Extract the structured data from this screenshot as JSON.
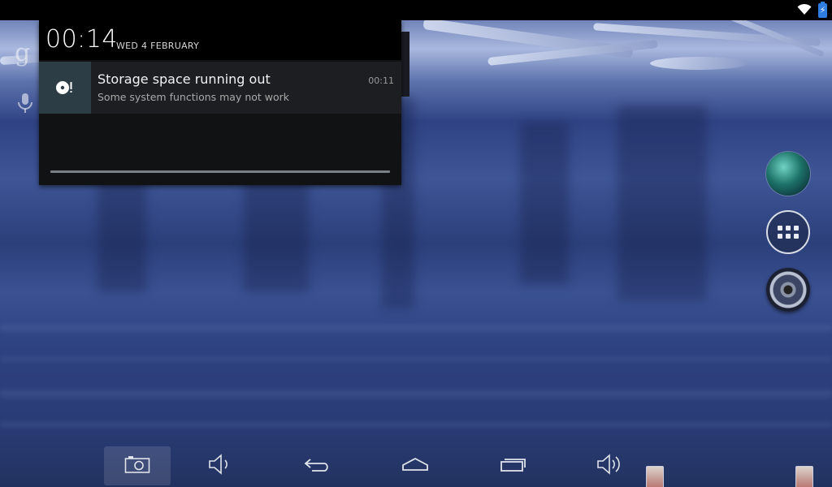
{
  "status_bar": {
    "icons": [
      "wifi-icon",
      "battery-charging-icon"
    ]
  },
  "search_bar": {
    "logo_letter": "g",
    "icons": [
      "mic-icon"
    ]
  },
  "notification_shade": {
    "clock": "00:14",
    "date": "WED 4 FEBRUARY",
    "notifications": [
      {
        "icon": "storage-warning-icon",
        "title": "Storage space running out",
        "text": "Some system functions may not work",
        "time": "00:11"
      }
    ]
  },
  "dock": {
    "items": [
      "browser-globe-icon",
      "app-drawer-icon",
      "music-speaker-icon"
    ]
  },
  "nav_bar": {
    "buttons": [
      "screenshot-icon",
      "volume-down-icon",
      "back-icon",
      "home-icon",
      "recents-icon",
      "volume-up-icon"
    ]
  },
  "colors": {
    "status_bar": "#000000",
    "shade_background": "#111214",
    "notification_icon_bg": "#2d3d46",
    "battery": "#2f7de1"
  }
}
